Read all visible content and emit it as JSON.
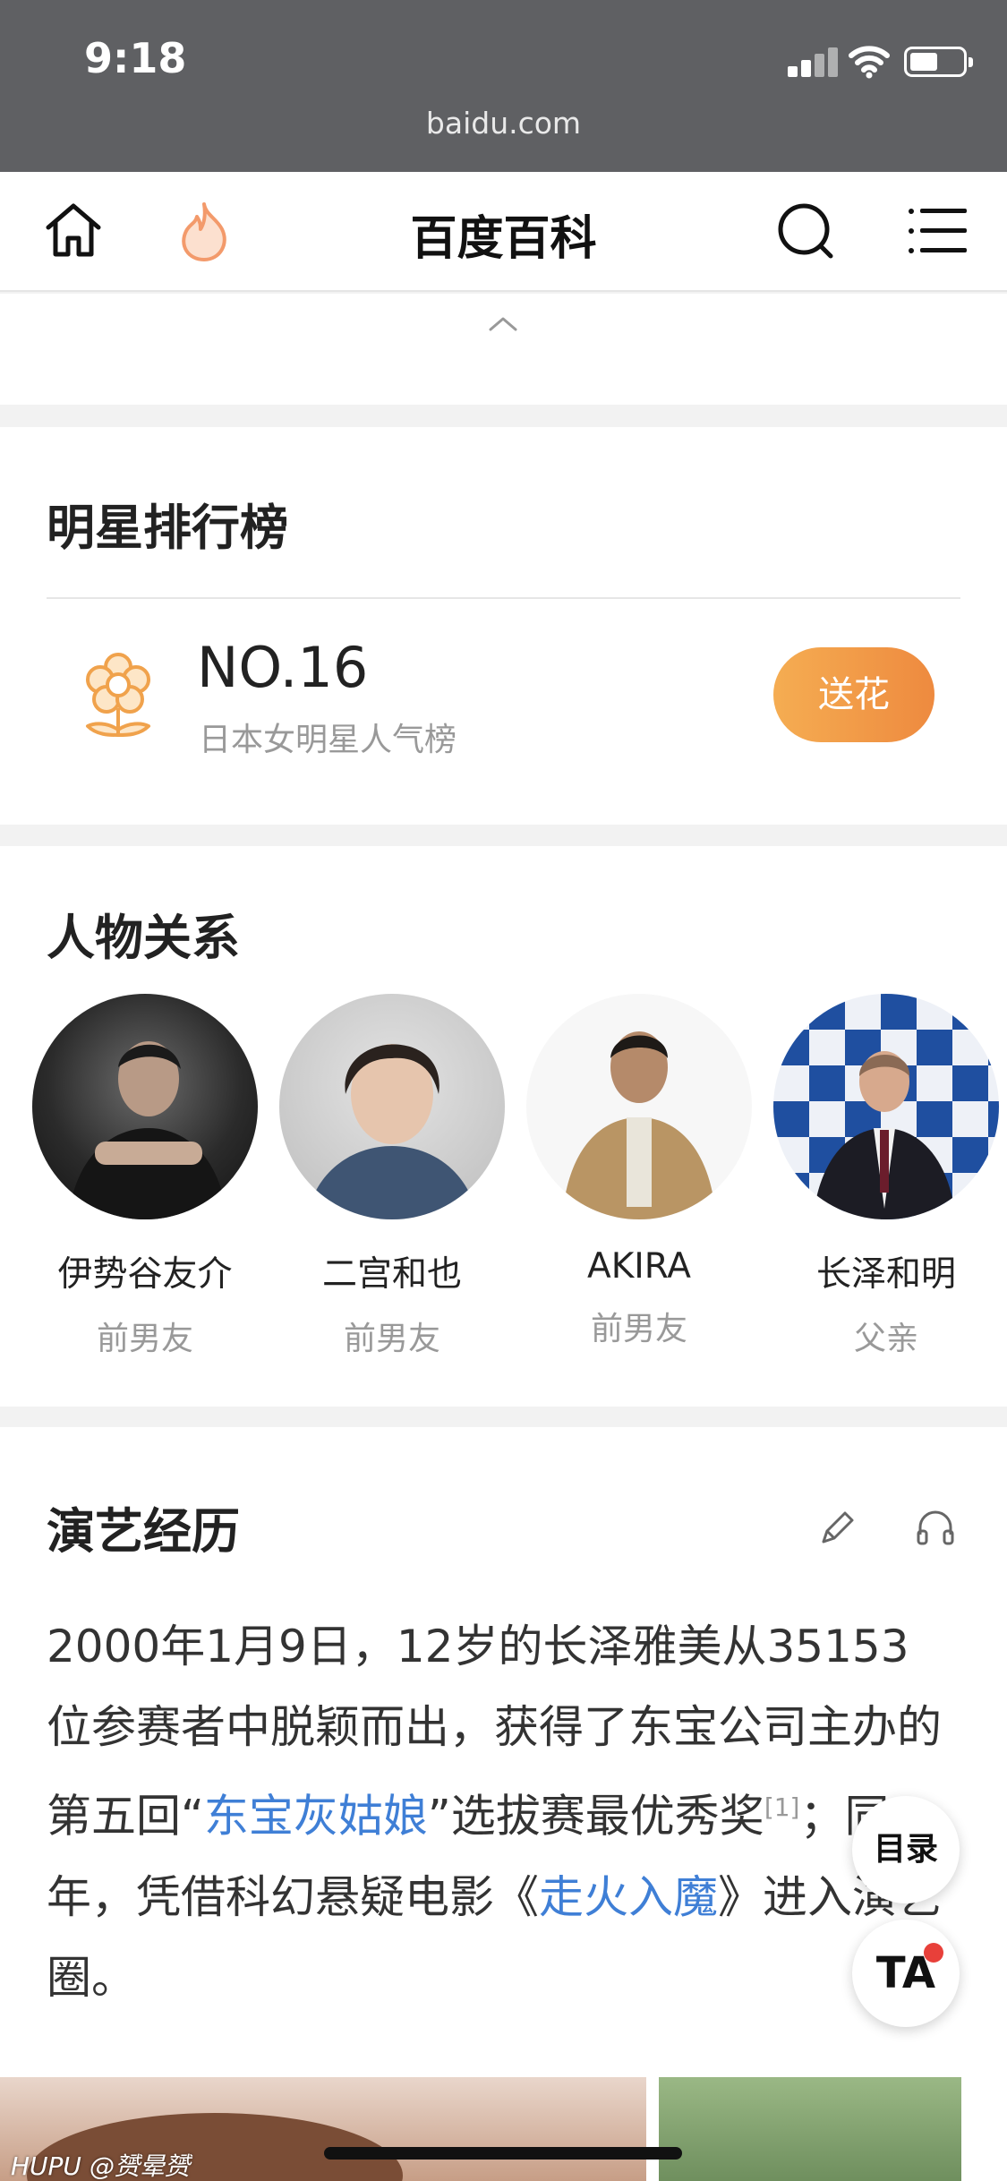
{
  "status_bar": {
    "time": "9:18",
    "url": "baidu.com"
  },
  "nav": {
    "title": "百度百科",
    "icons": [
      "home-icon",
      "flame-icon",
      "search-icon",
      "menu-icon"
    ]
  },
  "ranking": {
    "title": "明星排行榜",
    "rank": "NO.16",
    "list_name": "日本女明星人气榜",
    "button_label": "送花",
    "accent_color": "#f09a44"
  },
  "relations": {
    "title": "人物关系",
    "people": [
      {
        "name": "伊势谷友介",
        "relation": "前男友"
      },
      {
        "name": "二宫和也",
        "relation": "前男友"
      },
      {
        "name": "AKIRA",
        "relation": "前男友"
      },
      {
        "name": "长泽和明",
        "relation": "父亲"
      }
    ]
  },
  "career": {
    "title": "演艺经历",
    "text_1": "2000年1月9日，12岁的长泽雅美从35153位参赛者中脱颖而出，获得了东宝公司主办的第五回“",
    "link_1": "东宝灰姑娘",
    "text_2": "”选拔赛最优秀奖",
    "ref": "[1]",
    "text_3": "；同年，凭借科幻悬疑电影《",
    "link_2": "走火入魔",
    "text_4": "》进入演艺圈。",
    "link_color": "#3f7fd6"
  },
  "floating": {
    "toc_label": "目录",
    "font_label": "TA"
  },
  "watermark": "HUPU @赟晕赟"
}
